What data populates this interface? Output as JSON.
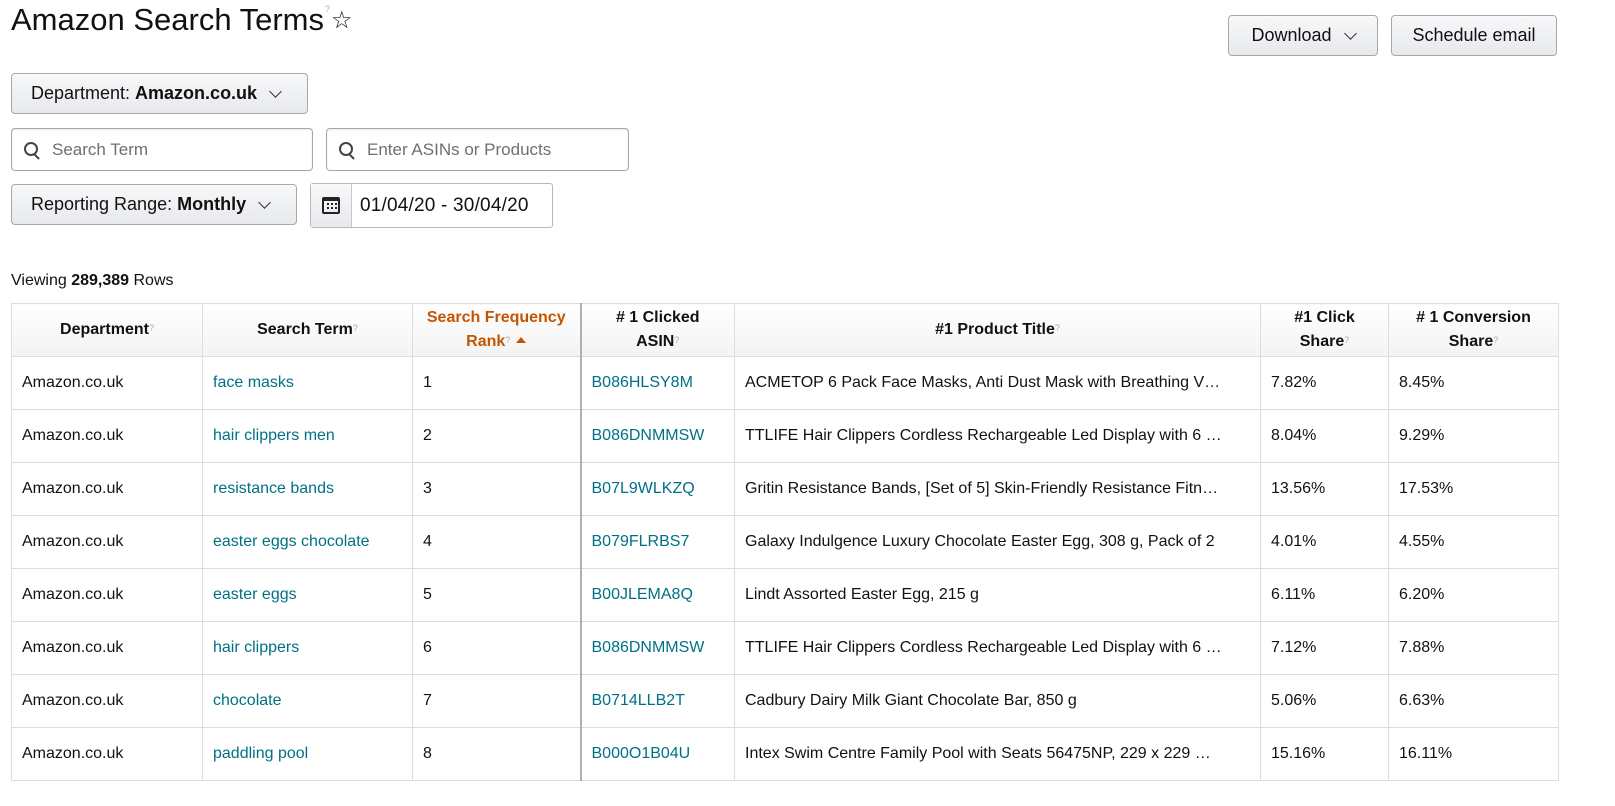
{
  "header": {
    "title": "Amazon Search Terms",
    "help_mark": "?",
    "star_icon": "star-outline-icon",
    "download_label": "Download",
    "schedule_label": "Schedule email"
  },
  "filters": {
    "department_label": "Department:",
    "department_value": "Amazon.co.uk",
    "search_term_placeholder": "Search Term",
    "asin_placeholder": "Enter ASINs or Products",
    "reporting_label": "Reporting Range:",
    "reporting_value": "Monthly",
    "date_range": "01/04/20 - 30/04/20"
  },
  "summary": {
    "viewing_prefix": "Viewing",
    "row_count": "289,389",
    "rows_suffix": "Rows"
  },
  "table": {
    "columns": [
      {
        "line1": "Department",
        "line2": ""
      },
      {
        "line1": "Search Term",
        "line2": ""
      },
      {
        "line1": "Search Frequency",
        "line2": "Rank"
      },
      {
        "line1": "# 1 Clicked",
        "line2": "ASIN"
      },
      {
        "line1": "#1 Product Title",
        "line2": ""
      },
      {
        "line1": "#1 Click",
        "line2": "Share"
      },
      {
        "line1": "# 1 Conversion",
        "line2": "Share"
      }
    ],
    "help_mark": "?",
    "rows": [
      {
        "department": "Amazon.co.uk",
        "search_term": "face masks",
        "rank": "1",
        "asin": "B086HLSY8M",
        "product_title": "ACMETOP 6 Pack Face Masks, Anti Dust Mask with Breathing V…",
        "click_share": "7.82%",
        "conversion_share": "8.45%"
      },
      {
        "department": "Amazon.co.uk",
        "search_term": "hair clippers men",
        "rank": "2",
        "asin": "B086DNMMSW",
        "product_title": "TTLIFE Hair Clippers Cordless Rechargeable Led Display with 6 …",
        "click_share": "8.04%",
        "conversion_share": "9.29%"
      },
      {
        "department": "Amazon.co.uk",
        "search_term": "resistance bands",
        "rank": "3",
        "asin": "B07L9WLKZQ",
        "product_title": "Gritin Resistance Bands, [Set of 5] Skin-Friendly Resistance Fitn…",
        "click_share": "13.56%",
        "conversion_share": "17.53%"
      },
      {
        "department": "Amazon.co.uk",
        "search_term": "easter eggs chocolate",
        "rank": "4",
        "asin": "B079FLRBS7",
        "product_title": "Galaxy Indulgence Luxury Chocolate Easter Egg, 308 g, Pack of 2",
        "click_share": "4.01%",
        "conversion_share": "4.55%"
      },
      {
        "department": "Amazon.co.uk",
        "search_term": "easter eggs",
        "rank": "5",
        "asin": "B00JLEMA8Q",
        "product_title": "Lindt Assorted Easter Egg, 215 g",
        "click_share": "6.11%",
        "conversion_share": "6.20%"
      },
      {
        "department": "Amazon.co.uk",
        "search_term": "hair clippers",
        "rank": "6",
        "asin": "B086DNMMSW",
        "product_title": "TTLIFE Hair Clippers Cordless Rechargeable Led Display with 6 …",
        "click_share": "7.12%",
        "conversion_share": "7.88%"
      },
      {
        "department": "Amazon.co.uk",
        "search_term": "chocolate",
        "rank": "7",
        "asin": "B0714LLB2T",
        "product_title": "Cadbury Dairy Milk Giant Chocolate Bar, 850 g",
        "click_share": "5.06%",
        "conversion_share": "6.63%"
      },
      {
        "department": "Amazon.co.uk",
        "search_term": "paddling pool",
        "rank": "8",
        "asin": "B000O1B04U",
        "product_title": "Intex Swim Centre Family Pool with Seats 56475NP, 229 x 229 …",
        "click_share": "15.16%",
        "conversion_share": "16.11%"
      }
    ]
  },
  "colors": {
    "link": "#007185",
    "sorted_header": "#c45500"
  }
}
